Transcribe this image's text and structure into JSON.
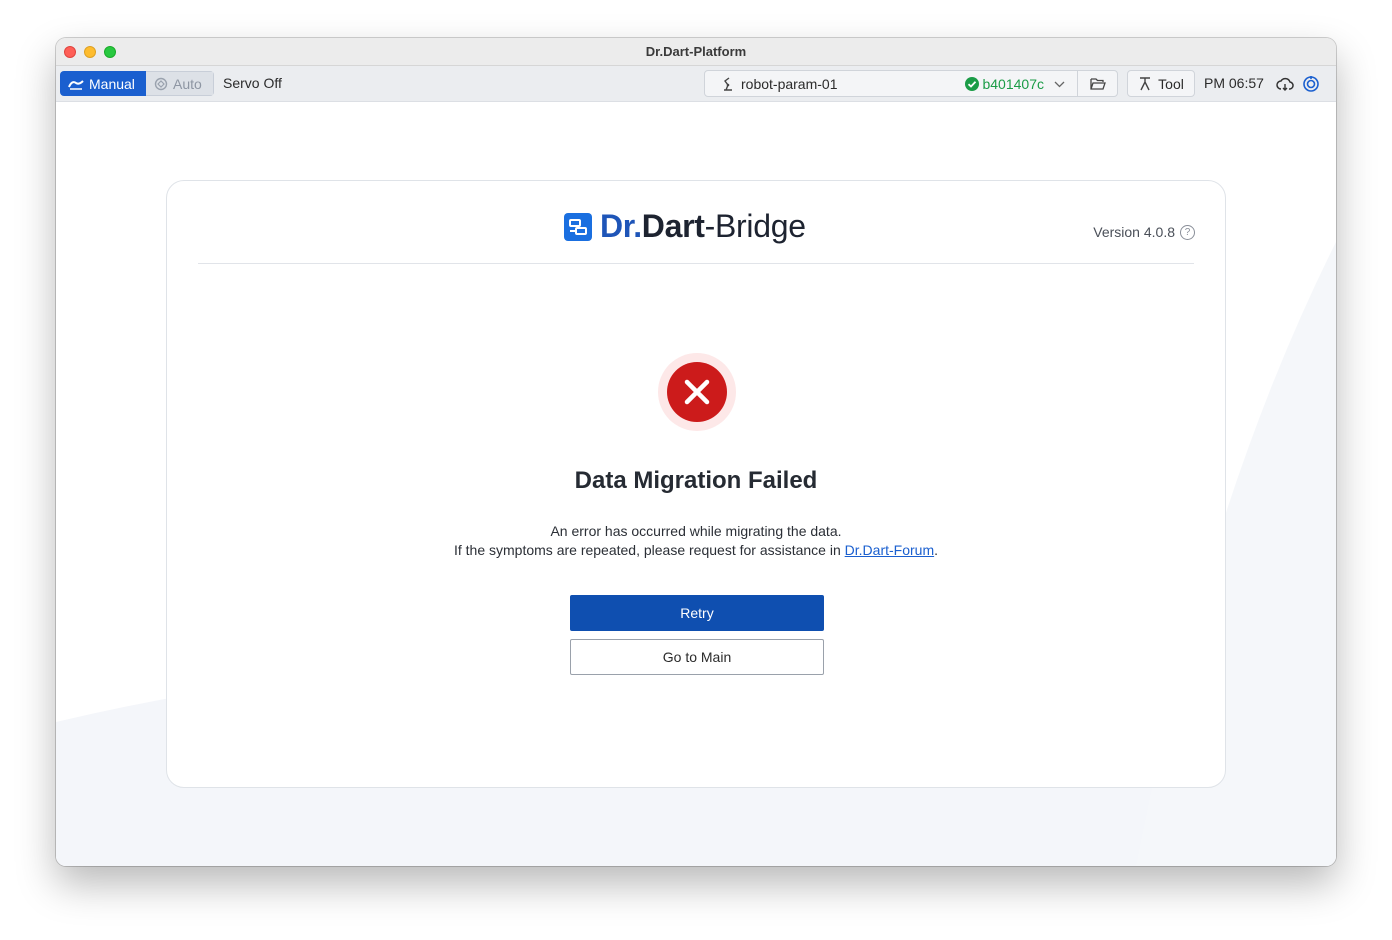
{
  "window": {
    "title": "Dr.Dart-Platform"
  },
  "toolbar": {
    "mode_manual": "Manual",
    "mode_auto": "Auto",
    "servo_status": "Servo Off",
    "robot_name": "robot-param-01",
    "robot_hash": "b401407c",
    "tool_label": "Tool",
    "clock": "PM 06:57"
  },
  "card": {
    "brand_dr": "Dr",
    "brand_dot": ".",
    "brand_dart": "Dart",
    "brand_dash": "-",
    "brand_bridge": "Bridge",
    "version": "Version 4.0.8",
    "help_glyph": "?"
  },
  "error": {
    "title": "Data Migration Failed",
    "line1": "An error has occurred while migrating the data.",
    "line2_prefix": "If the symptoms are repeated, please request for assistance in ",
    "link_text": "Dr.Dart-Forum",
    "line2_suffix": "."
  },
  "actions": {
    "retry": "Retry",
    "go_main": "Go to Main"
  },
  "colors": {
    "accent": "#1a5fcf",
    "primary_button": "#0f4fb0",
    "error_red": "#cc1b1b",
    "success_green": "#1b9c47"
  },
  "icons": [
    "manual-mode-icon",
    "auto-mode-icon",
    "robot-arm-icon",
    "check-circle-icon",
    "chevron-down-icon",
    "folder-open-icon",
    "tool-icon",
    "cloud-sync-icon",
    "power-cycle-icon",
    "bridge-logo-icon",
    "help-icon",
    "error-x-icon"
  ]
}
